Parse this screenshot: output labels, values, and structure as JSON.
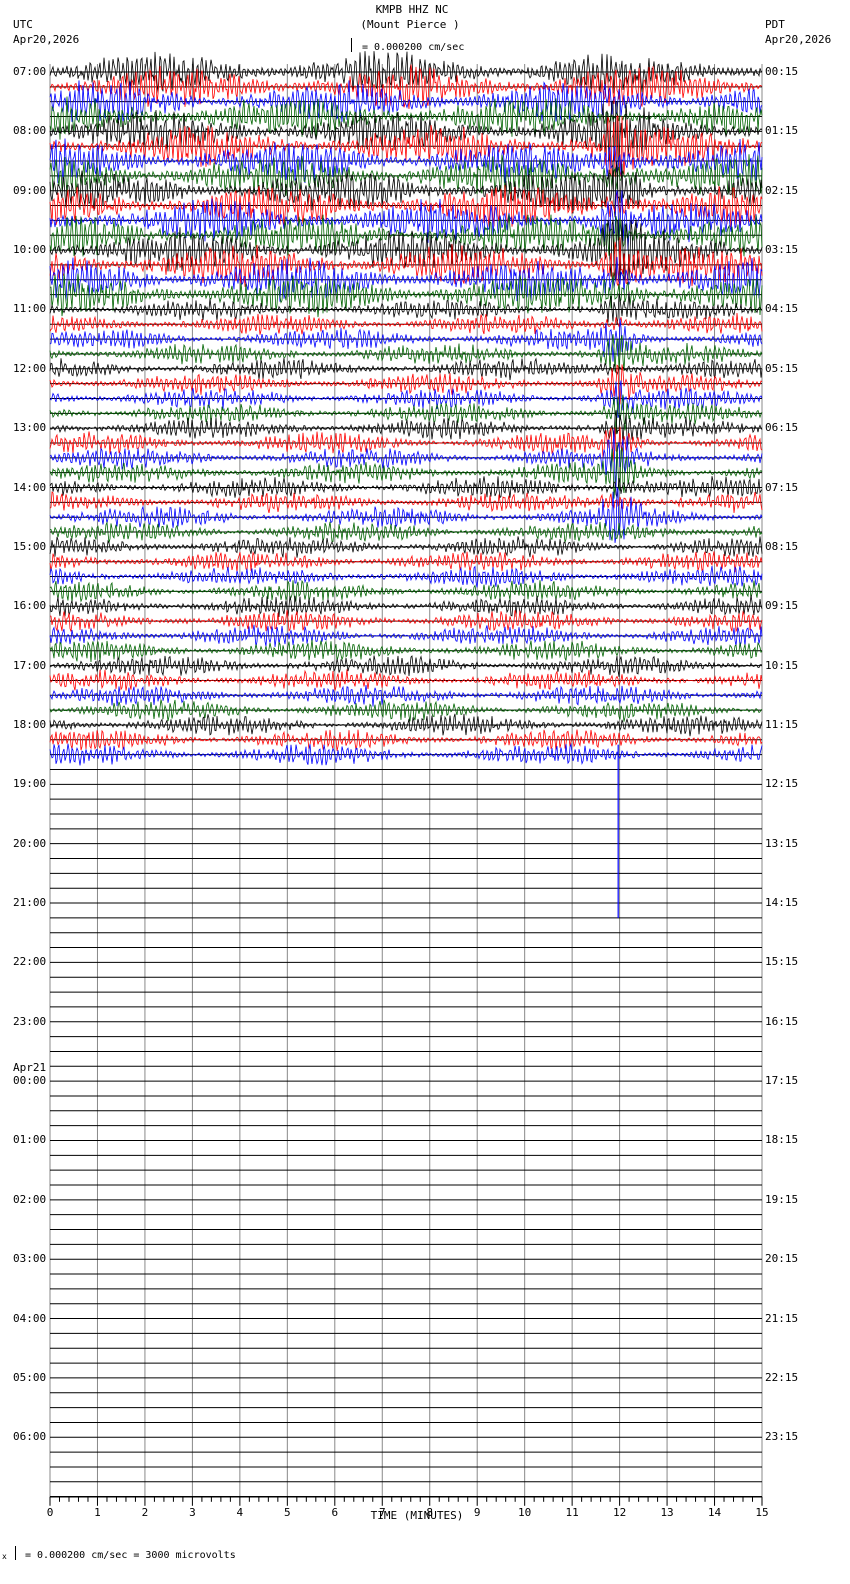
{
  "header": {
    "station": "KMPB HHZ NC",
    "location": "(Mount Pierce )",
    "scale": "= 0.000200 cm/sec",
    "left_tz": "UTC",
    "left_date": "Apr20,2026",
    "right_tz": "PDT",
    "right_date": "Apr20,2026"
  },
  "footer": {
    "scale_note": "= 0.000200 cm/sec =    3000 microvolts",
    "mark": "x"
  },
  "chart_data": {
    "type": "line",
    "title": "KMPB HHZ NC (Mount Pierce )",
    "xlabel": "TIME (MINUTES)",
    "xlim": [
      0,
      15
    ],
    "x_ticks": [
      "0",
      "1",
      "2",
      "3",
      "4",
      "5",
      "6",
      "7",
      "8",
      "9",
      "10",
      "11",
      "12",
      "13",
      "14",
      "15"
    ],
    "traces_per_hour": 4,
    "total_traces": 96,
    "traces_with_data": 47,
    "trace_colors": [
      "#000000",
      "#ff0000",
      "#0000ff",
      "#006400"
    ],
    "grid_color": "#888888",
    "left_hour_labels": [
      "07:00",
      "08:00",
      "09:00",
      "10:00",
      "11:00",
      "12:00",
      "13:00",
      "14:00",
      "15:00",
      "16:00",
      "17:00",
      "18:00",
      "19:00",
      "20:00",
      "21:00",
      "22:00",
      "23:00",
      "00:00",
      "01:00",
      "02:00",
      "03:00",
      "04:00",
      "05:00",
      "06:00"
    ],
    "day_change_label": "Apr21",
    "day_change_index": 17,
    "right_hour_labels": [
      "00:15",
      "01:15",
      "02:15",
      "03:15",
      "04:15",
      "05:15",
      "06:15",
      "07:15",
      "08:15",
      "09:15",
      "10:15",
      "11:15",
      "12:15",
      "13:15",
      "14:15",
      "15:15",
      "16:15",
      "17:15",
      "18:15",
      "19:15",
      "20:15",
      "21:15",
      "22:15",
      "23:15"
    ],
    "noise_level": {
      "high_rows_until": 16,
      "high": 1.0,
      "moderate": 0.5
    },
    "event": {
      "start_minute": 11.6,
      "end_minute": 12.6,
      "peak_minute": 11.95,
      "first_row": 4,
      "last_row": 30
    }
  }
}
